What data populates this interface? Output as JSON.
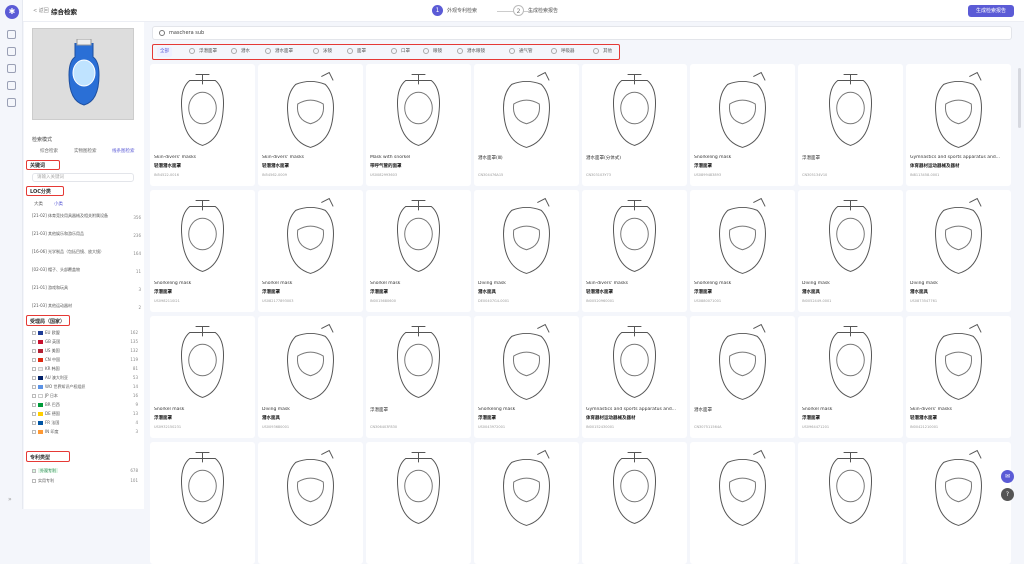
{
  "header": {
    "back_label": "< 返回",
    "title": "综合检索",
    "step1": "外观专利检索",
    "step2": "生成检索报告",
    "report_button": "生成检索报告"
  },
  "left": {
    "mode_label": "检索模式",
    "mode_options": [
      "综合检索",
      "实物图检索",
      "线条图检索"
    ],
    "keyword_title": "关键词",
    "keyword_placeholder": "请输入关键词",
    "loc_title": "LOC分类",
    "loc_tabs": [
      "大类",
      "小类"
    ],
    "loc_items": [
      {
        "text": "[21-02] 体育竞技用具器械及相关附属设备",
        "count": "356"
      },
      {
        "text": "[21-03] 其他娱乐和游乐用品",
        "count": "236"
      },
      {
        "text": "[16-06] 光学制品（包括目镜、放大镜）",
        "count": "164"
      },
      {
        "text": "[02-03] 帽子、头部覆盖物",
        "count": "11"
      },
      {
        "text": "[21-01] 游戏和玩具",
        "count": "3"
      },
      {
        "text": "[21-03] 其他运动器材",
        "count": "2"
      }
    ],
    "country_title": "受理局（国家）",
    "countries": [
      {
        "name": "EU 欧盟",
        "count": "162",
        "color": "#1e3c96"
      },
      {
        "name": "GB 英国",
        "count": "135",
        "color": "#c8102e"
      },
      {
        "name": "US 美国",
        "count": "132",
        "color": "#b22234"
      },
      {
        "name": "CN 中国",
        "count": "119",
        "color": "#de2910"
      },
      {
        "name": "KR 韩国",
        "count": "81",
        "color": "#eeeeee"
      },
      {
        "name": "AU 澳大利亚",
        "count": "53",
        "color": "#012169"
      },
      {
        "name": "WO 世界知识产权组织",
        "count": "14",
        "color": "#5b92e5"
      },
      {
        "name": "JP 日本",
        "count": "16",
        "color": "#ffffff"
      },
      {
        "name": "BR 巴西",
        "count": "9",
        "color": "#009b3a"
      },
      {
        "name": "DE 德国",
        "count": "13",
        "color": "#ffce00"
      },
      {
        "name": "FR 法国",
        "count": "4",
        "color": "#0055a4"
      },
      {
        "name": "IN 印度",
        "count": "3",
        "color": "#ff9933"
      }
    ],
    "type_title": "专利类型",
    "types": [
      {
        "name": "外观专利",
        "count": "678"
      },
      {
        "name": "实用专利",
        "count": "101"
      }
    ]
  },
  "main": {
    "query": "maschera sub",
    "filters": [
      "全部",
      "浮潜面罩",
      "潜水",
      "潜水面罩",
      "泳镜",
      "面罩",
      "口罩",
      "眼镜",
      "潜水眼镜",
      "通气管",
      "呼吸器",
      "其他"
    ],
    "cards": [
      {
        "t1": "Skin-divers' masks",
        "t2": "轻潜潜水面罩",
        "t3": "IN54522-0016"
      },
      {
        "t1": "Skin-divers' masks",
        "t2": "轻潜潜水面罩",
        "t3": "IN54562-0009"
      },
      {
        "t1": "Mask with snorkel",
        "t2": "带呼气管的面罩",
        "t3": "US0082993603"
      },
      {
        "t1": "潜水面罩(Ⅲ)",
        "t2": "",
        "t3": "CN304476A15"
      },
      {
        "t1": "潜水面罩(分体式)",
        "t2": "",
        "t3": "CN303103Y73"
      },
      {
        "t1": "Snorkeling mask",
        "t2": "浮潜面罩",
        "t3": "US0899483893"
      },
      {
        "t1": "浮潜面罩",
        "t2": "",
        "t3": "CN305134V10"
      },
      {
        "t1": "Gymnastics and sports apparatus and...",
        "t2": "体育器材运动器械及器材",
        "t3": "IN8113458-0001"
      },
      {
        "t1": "Snorkeling mask",
        "t2": "浮潜面罩",
        "t3": "US0982110I21"
      },
      {
        "t1": "Snorkel mask",
        "t2": "浮潜面罩",
        "t3": "US082177893003"
      },
      {
        "t1": "Snorkel mask",
        "t2": "浮潜面罩",
        "t3": "IN0015680600"
      },
      {
        "t1": "Diving mask",
        "t2": "潜水面具",
        "t3": "DE00407G4-0001"
      },
      {
        "t1": "Skin-divers' masks",
        "t2": "轻潜潜水面罩",
        "t3": "IN00520960001"
      },
      {
        "t1": "Snorkeling mask",
        "t2": "浮潜面罩",
        "t3": "US0880071001"
      },
      {
        "t1": "Diving mask",
        "t2": "潜水面具",
        "t3": "IN0052449-0001"
      },
      {
        "t1": "Diving mask",
        "t2": "潜水面具",
        "t3": "US0873547761"
      },
      {
        "t1": "Snorkel mask",
        "t2": "浮潜面罩",
        "t3": "US0932150231"
      },
      {
        "t1": "Diving mask",
        "t2": "潜水面具",
        "t3": "US0093680001"
      },
      {
        "t1": "浮潜面罩",
        "t2": "",
        "t3": "CN306403F830"
      },
      {
        "t1": "Snorkeling mask",
        "t2": "浮潜面罩",
        "t3": "US0043972001"
      },
      {
        "t1": "Gymnastics and sports apparatus and...",
        "t2": "体育器材运动器械及器材",
        "t3": "IN00152430001"
      },
      {
        "t1": "潜水面罩",
        "t2": "",
        "t3": "CN307511564A"
      },
      {
        "t1": "Snorkel mask",
        "t2": "浮潜面罩",
        "t3": "US0964471201"
      },
      {
        "t1": "Skin-divers' masks",
        "t2": "轻潜潜水面罩",
        "t3": "IN00421210001"
      },
      {
        "t1": "",
        "t2": "",
        "t3": ""
      },
      {
        "t1": "",
        "t2": "",
        "t3": ""
      },
      {
        "t1": "",
        "t2": "",
        "t3": ""
      },
      {
        "t1": "",
        "t2": "",
        "t3": ""
      },
      {
        "t1": "",
        "t2": "",
        "t3": ""
      },
      {
        "t1": "",
        "t2": "",
        "t3": ""
      },
      {
        "t1": "",
        "t2": "",
        "t3": ""
      },
      {
        "t1": "",
        "t2": "",
        "t3": ""
      }
    ]
  },
  "colors": {
    "accent": "#5b5bd6",
    "highlight": "#e53935"
  }
}
